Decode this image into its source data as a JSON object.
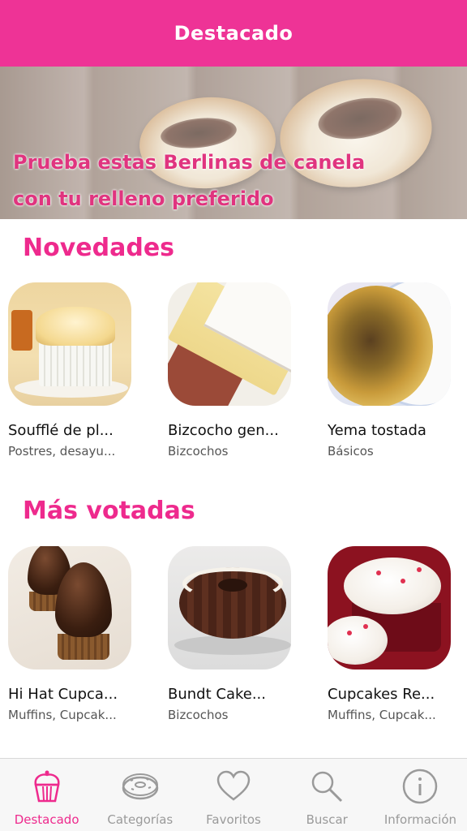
{
  "header": {
    "title": "Destacado"
  },
  "banner": {
    "line1": "Prueba estas Berlinas de canela",
    "line2": "con tu relleno preferido"
  },
  "novedades": {
    "title": "Novedades",
    "items": [
      {
        "name": "Soufflé de pl...",
        "category": "Postres, desayu..."
      },
      {
        "name": "Bizcocho gen...",
        "category": "Bizcochos"
      },
      {
        "name": "Yema tostada",
        "category": "Básicos"
      }
    ]
  },
  "mas_votadas": {
    "title": "Más votadas",
    "items": [
      {
        "name": "Hi Hat Cupca...",
        "category": "Muffins, Cupcak..."
      },
      {
        "name": "Bundt Cake...",
        "category": "Bizcochos"
      },
      {
        "name": "Cupcakes Re...",
        "category": "Muffins, Cupcak..."
      }
    ]
  },
  "tabbar": {
    "tabs": [
      {
        "label": "Destacado",
        "icon": "cupcake-icon",
        "active": true
      },
      {
        "label": "Categorías",
        "icon": "donut-icon",
        "active": false
      },
      {
        "label": "Favoritos",
        "icon": "heart-icon",
        "active": false
      },
      {
        "label": "Buscar",
        "icon": "search-icon",
        "active": false
      },
      {
        "label": "Información",
        "icon": "info-icon",
        "active": false
      }
    ]
  },
  "colors": {
    "accent": "#ee2a8d",
    "header": "#ee3396",
    "inactive": "#9a9a9a"
  }
}
